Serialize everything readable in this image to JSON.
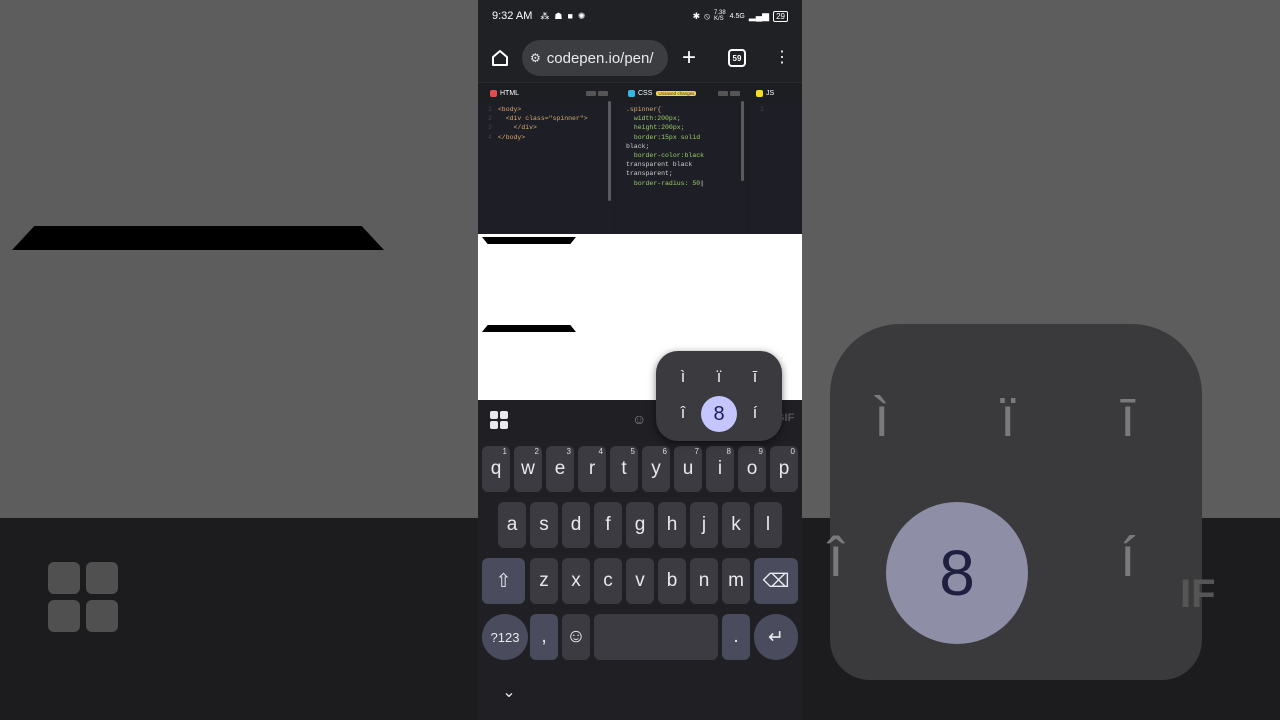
{
  "status_bar": {
    "time": "9:32 AM",
    "net_speed_top": "7.38",
    "net_speed_bottom": "K/S",
    "network": "4.5G",
    "battery": "29"
  },
  "browser": {
    "url": "codepen.io/pen/",
    "tab_count": "59"
  },
  "editor": {
    "html_tab": "HTML",
    "css_tab": "CSS",
    "css_badge": "Unsaved changes",
    "js_tab": "JS",
    "html_lines": [
      "<body>",
      "<div class=\"spinner\">",
      "</div>",
      "</body>"
    ],
    "css_lines": [
      ".spinner{",
      "width:200px;",
      "height:200px;",
      "border:15px solid",
      "black;",
      "border-color:black",
      "transparent black",
      "transparent;",
      "border-radius: 50"
    ]
  },
  "keyboard": {
    "row1": [
      "q",
      "w",
      "e",
      "r",
      "t",
      "y",
      "u",
      "i",
      "o",
      "p"
    ],
    "row1_hints": [
      "1",
      "2",
      "3",
      "4",
      "5",
      "6",
      "7",
      "8",
      "9",
      "0"
    ],
    "row2": [
      "a",
      "s",
      "d",
      "f",
      "g",
      "h",
      "j",
      "k",
      "l"
    ],
    "row3": [
      "z",
      "x",
      "c",
      "v",
      "b",
      "n",
      "m"
    ],
    "symbols_key": "?123",
    "comma_key": ",",
    "period_key": ".",
    "gif_label": "GIF",
    "accent_popup": {
      "row1": [
        "ì",
        "ï",
        "ī"
      ],
      "row2": [
        "î",
        "8",
        "í"
      ],
      "selected": "8"
    }
  },
  "colors": {
    "accent_selected": "#c5c6ff",
    "codepen_bg": "#1d1e22"
  }
}
